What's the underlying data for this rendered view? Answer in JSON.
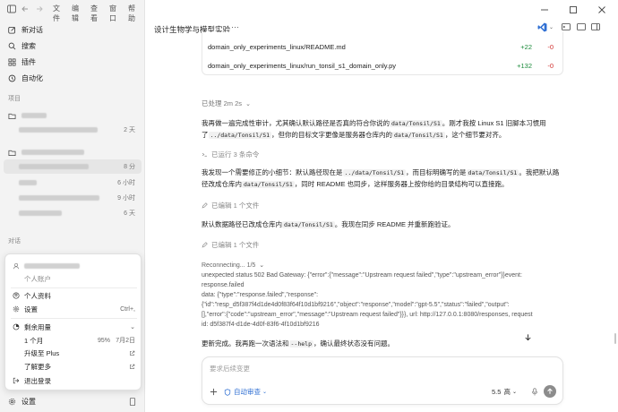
{
  "menu": [
    "文件",
    "编辑",
    "查看",
    "窗口",
    "帮助"
  ],
  "nav": [
    "新对话",
    "搜索",
    "插件",
    "自动化"
  ],
  "sections": {
    "projects": "项目",
    "conversations": "对话"
  },
  "projects": [
    {
      "time": "2 天"
    },
    {
      "time": ""
    },
    {
      "time": "8 分"
    },
    {
      "time": "6 小时"
    },
    {
      "time": "9 小时"
    },
    {
      "time": "6 天"
    }
  ],
  "popup": {
    "personal_account": "个人账户",
    "profile": "个人资料",
    "settings": "设置",
    "settings_shortcut": "Ctrl+,",
    "remaining_usage": "剩余用量",
    "month_label": "1 个月",
    "month_value": "95%",
    "month_date": "7月2日",
    "upgrade": "升级至 Plus",
    "learn_more": "了解更多",
    "logout": "退出登录"
  },
  "sidebar_settings": "设置",
  "thread": {
    "title": "设计生物学与模型实验",
    "more": "···"
  },
  "diff": [
    {
      "file": "domain_only_experiments_linux/README.md",
      "added": "+22",
      "removed": "-0"
    },
    {
      "file": "domain_only_experiments_linux/run_tonsil_s1_domain_only.py",
      "added": "+132",
      "removed": "-0"
    }
  ],
  "processed": "已处理 2m 2s",
  "para1": {
    "t1": "我再做一遍完成性审计，尤其确认默认路径是否真的符合你说的",
    "c1": "data/Tonsil/S1",
    "t2": "。刚才我按 Linux S1 旧脚本习惯用了",
    "c2": "../data/Tonsil/S1",
    "t3": "，但你的目标文字更像是服务器仓库内的",
    "c3": "data/Tonsil/S1",
    "t4": "，这个细节要对齐。"
  },
  "ran_commands": "已运行 3 条命令",
  "para2": {
    "t1": "我发现一个需要修正的小细节：默认路径现在是",
    "c1": "../data/Tonsil/S1",
    "t2": "，而目标明确写的是",
    "c2": "data/Tonsil/S1",
    "t3": "。我把默认路径改成仓库内",
    "c3": "data/Tonsil/S1",
    "t4": "，同时 README 也同步，这样服务器上按你给的目录结构可以直接跑。"
  },
  "edited1": "已编辑 1 个文件",
  "para3": {
    "t1": "默认数据路径已改成仓库内",
    "c1": "data/Tonsil/S1",
    "t2": "。我现在同步 README 并重新跑验证。"
  },
  "edited2": "已编辑 1 个文件",
  "reconnecting": "Reconnecting... 1/5",
  "error_lines": [
    "unexpected status 502 Bad Gateway: {\"error\":{\"message\":\"Upstream request failed\",\"type\":\"upstream_error\"}}event:",
    "response.failed",
    "data: {\"type\":\"response.failed\",\"response\":",
    "{\"id\":\"resp_d5f387f4d1de4d0f83f64f10d1bf9216\",\"object\":\"response\",\"model\":\"gpt-5.5\",\"status\":\"failed\",\"output\":",
    "[],\"error\":{\"code\":\"upstream_error\",\"message\":\"Upstream request failed\"}}}, url: http://127.0.0.1:8080/responses, request",
    "id: d5f387f4-d1de-4d0f-83f6-4f10d1bf9216"
  ],
  "para4": {
    "t1": "更新完成。我再跑一次语法和",
    "c1": "--help",
    "t2": "，确认最终状态没有问题。"
  },
  "composer": {
    "placeholder": "要求后续变更",
    "auto_review": "自动审查",
    "model": "5.5",
    "effort": "高"
  },
  "colors": {
    "accent": "#2f6fd3",
    "add": "#1a8a3a",
    "remove": "#d0302f"
  }
}
